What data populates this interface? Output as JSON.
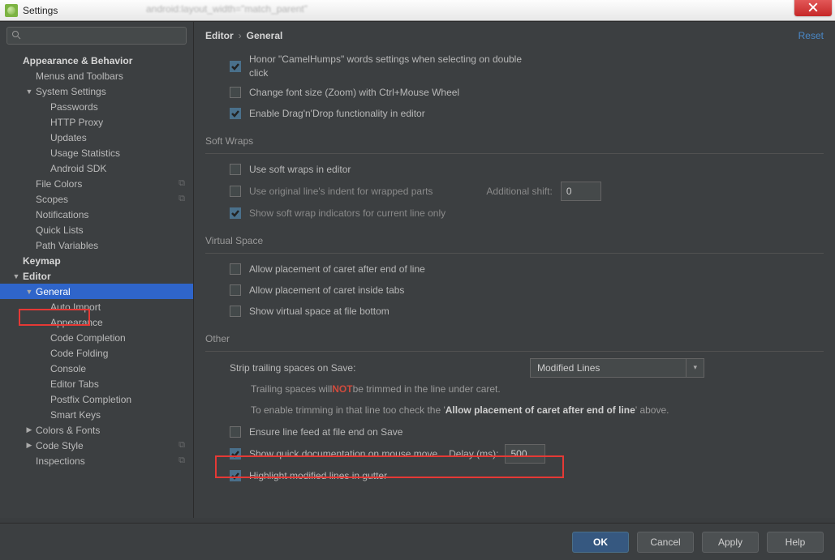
{
  "window": {
    "title": "Settings",
    "blurred_back_text": "android:layout_width=\"match_parent\""
  },
  "search": {
    "placeholder": ""
  },
  "reset_label": "Reset",
  "breadcrumb": {
    "a": "Editor",
    "b": "General"
  },
  "tree": {
    "appearance_behavior": "Appearance & Behavior",
    "menus_toolbars": "Menus and Toolbars",
    "system_settings": "System Settings",
    "passwords": "Passwords",
    "http_proxy": "HTTP Proxy",
    "updates": "Updates",
    "usage_stats": "Usage Statistics",
    "android_sdk": "Android SDK",
    "file_colors": "File Colors",
    "scopes": "Scopes",
    "notifications": "Notifications",
    "quick_lists": "Quick Lists",
    "path_variables": "Path Variables",
    "keymap": "Keymap",
    "editor": "Editor",
    "general": "General",
    "auto_import": "Auto Import",
    "appearance": "Appearance",
    "code_completion": "Code Completion",
    "code_folding": "Code Folding",
    "console": "Console",
    "editor_tabs": "Editor Tabs",
    "postfix": "Postfix Completion",
    "smart_keys": "Smart Keys",
    "colors_fonts": "Colors & Fonts",
    "code_style": "Code Style",
    "inspections": "Inspections"
  },
  "opts": {
    "honor": "Honor \"CamelHumps\" words settings when selecting on double click",
    "zoom": "Change font size (Zoom) with Ctrl+Mouse Wheel",
    "dnd": "Enable Drag'n'Drop functionality in editor",
    "soft_wraps_title": "Soft Wraps",
    "use_soft_wraps": "Use soft wraps in editor",
    "orig_indent": "Use original line's indent for wrapped parts",
    "additional_shift": "Additional shift:",
    "additional_shift_val": "0",
    "show_soft_ind": "Show soft wrap indicators for current line only",
    "virtual_title": "Virtual Space",
    "caret_eol": "Allow placement of caret after end of line",
    "caret_tabs": "Allow placement of caret inside tabs",
    "virt_bottom": "Show virtual space at file bottom",
    "other_title": "Other",
    "strip_label": "Strip trailing spaces on Save:",
    "strip_value": "Modified Lines",
    "note_a": "Trailing spaces will ",
    "note_not": "NOT",
    "note_b": " be trimmed in the line under caret.",
    "note_c": "To enable trimming in that line too check the '",
    "note_strong": "Allow placement of caret after end of line",
    "note_d": "' above.",
    "ensure_lf": "Ensure line feed at file end on Save",
    "quick_doc": "Show quick documentation on mouse move",
    "delay_label": "Delay (ms):",
    "delay_val": "500",
    "hl_gutter": "Highlight modified lines in gutter"
  },
  "buttons": {
    "ok": "OK",
    "cancel": "Cancel",
    "apply": "Apply",
    "help": "Help"
  }
}
